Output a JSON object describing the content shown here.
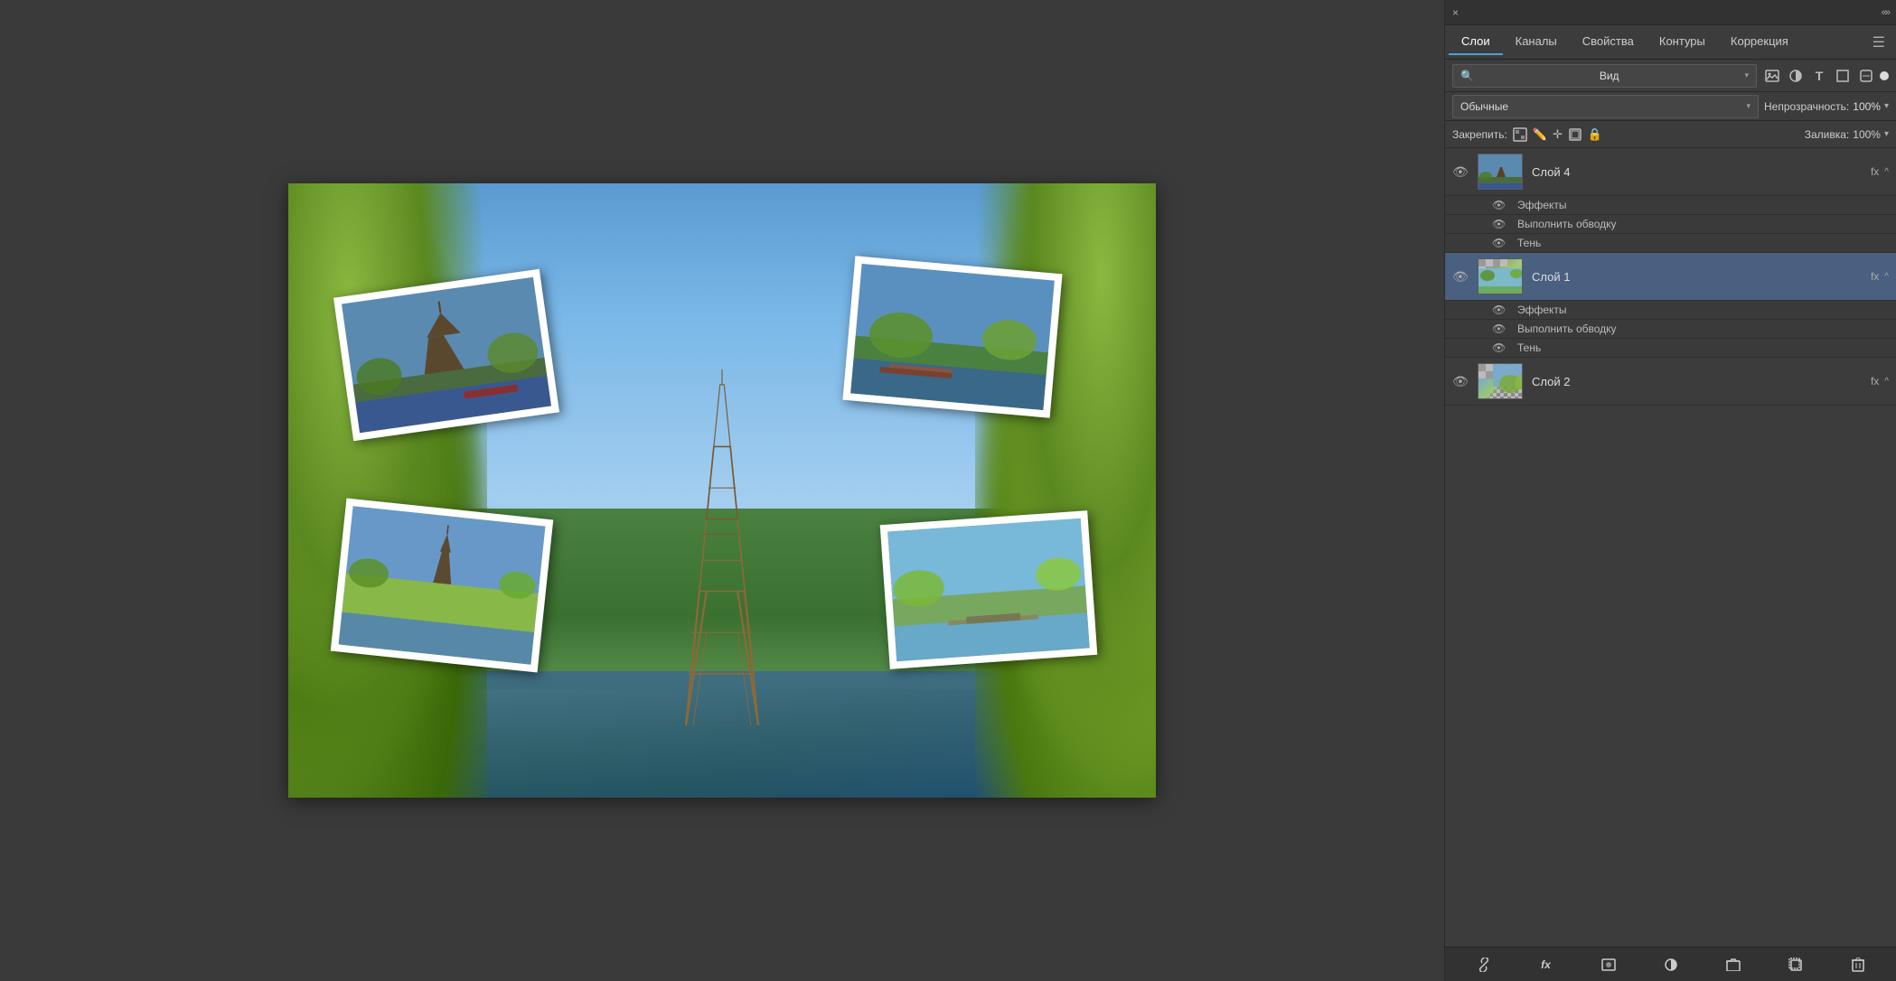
{
  "panel": {
    "close_label": "×",
    "collapse_label": "«»",
    "tabs": [
      {
        "id": "layers",
        "label": "Слои",
        "active": true
      },
      {
        "id": "channels",
        "label": "Каналы",
        "active": false
      },
      {
        "id": "properties",
        "label": "Свойства",
        "active": false
      },
      {
        "id": "paths",
        "label": "Контуры",
        "active": false
      },
      {
        "id": "corrections",
        "label": "Коррекция",
        "active": false
      }
    ],
    "menu_icon": "☰",
    "filter": {
      "label": "Вид",
      "placeholder": "Вид"
    },
    "blend_mode": {
      "label": "Обычные"
    },
    "opacity": {
      "label": "Непрозрачность:",
      "value": "100%"
    },
    "lock": {
      "label": "Закрепить:"
    },
    "fill": {
      "label": "Заливка:",
      "value": "100%"
    },
    "layers": [
      {
        "id": "layer4",
        "name": "Слой 4",
        "visible": true,
        "selected": false,
        "has_effects": true,
        "effects": [
          {
            "name": "Эффекты",
            "visible": true
          },
          {
            "name": "Выполнить обводку",
            "visible": true
          },
          {
            "name": "Тень",
            "visible": true
          }
        ],
        "thumb_class": "layer-thumb-1"
      },
      {
        "id": "layer1",
        "name": "Слой 1",
        "visible": true,
        "selected": true,
        "has_effects": true,
        "effects": [
          {
            "name": "Эффекты",
            "visible": true
          },
          {
            "name": "Выполнить обводку",
            "visible": true
          },
          {
            "name": "Тень",
            "visible": true
          }
        ],
        "thumb_class": "layer-thumb-2"
      },
      {
        "id": "layer2",
        "name": "Слой 2",
        "visible": true,
        "selected": false,
        "has_effects": false,
        "effects": [],
        "thumb_class": "layer-thumb-3"
      }
    ],
    "toolbar_buttons": [
      {
        "id": "link",
        "icon": "🔗",
        "label": "link-layers"
      },
      {
        "id": "fx",
        "icon": "fx",
        "label": "add-layer-style"
      },
      {
        "id": "mask",
        "icon": "⬜",
        "label": "add-mask"
      },
      {
        "id": "adjustment",
        "icon": "◐",
        "label": "new-adjustment"
      },
      {
        "id": "group",
        "icon": "📁",
        "label": "new-group"
      },
      {
        "id": "new-layer",
        "icon": "📄",
        "label": "new-layer"
      },
      {
        "id": "delete",
        "icon": "🗑",
        "label": "delete-layer"
      }
    ]
  }
}
